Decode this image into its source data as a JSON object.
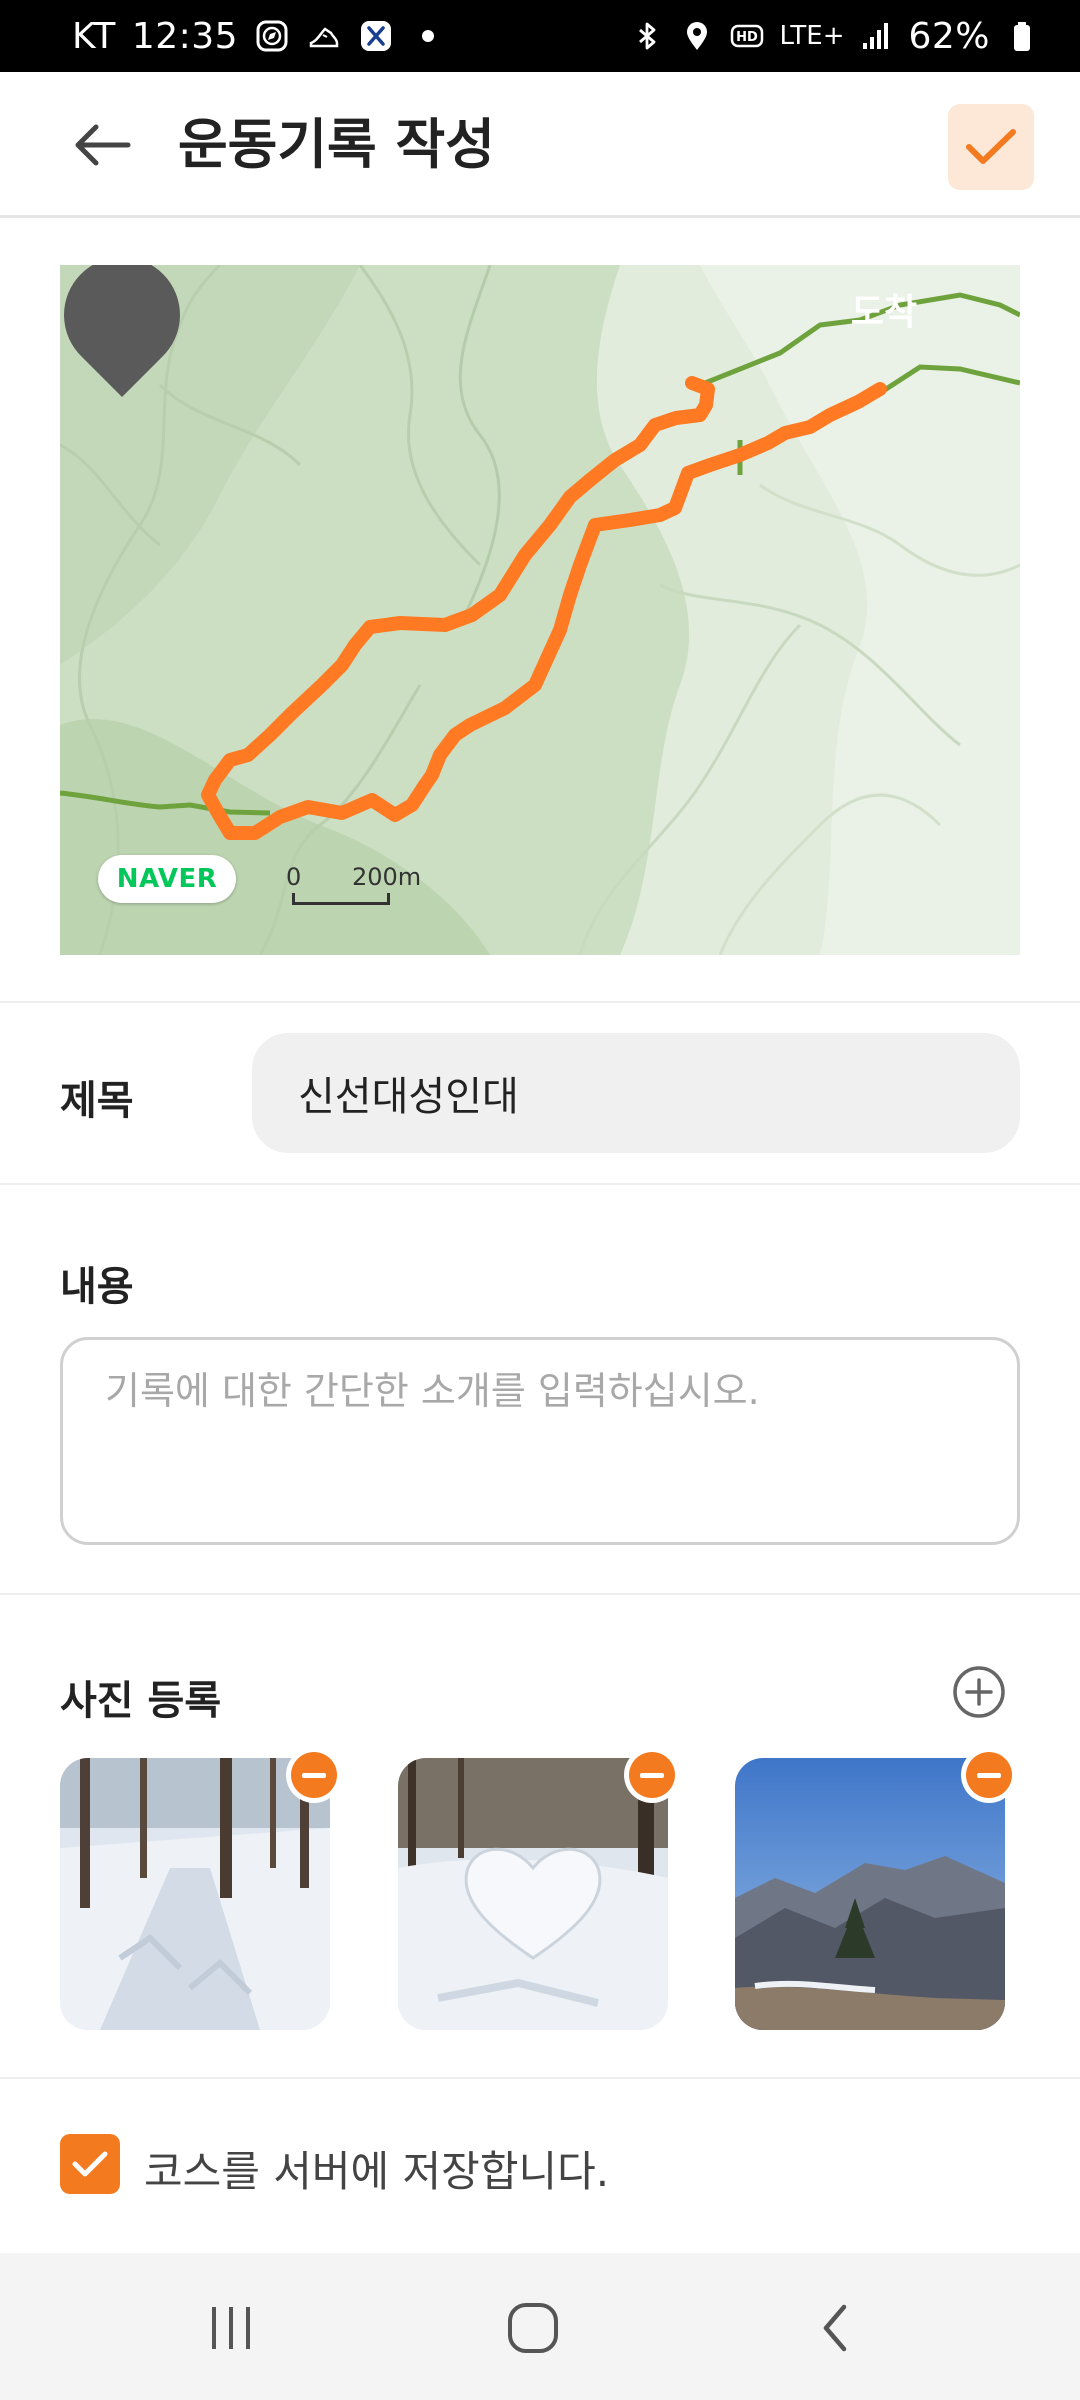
{
  "status_bar": {
    "carrier": "KT",
    "time": "12:35",
    "network": "LTE+",
    "battery": "62%",
    "icons": [
      "compass-icon",
      "running-shoe-icon",
      "x-app-icon",
      "dot-icon",
      "bluetooth-icon",
      "location-icon",
      "hd-icon",
      "signal-icon",
      "battery-icon"
    ]
  },
  "header": {
    "title": "운동기록 작성",
    "back_icon": "arrow-left-icon",
    "confirm_icon": "check-icon"
  },
  "map": {
    "arrival_label": "도착",
    "brand": "NAVER",
    "scale_zero": "0",
    "scale_label": "200m",
    "route_color": "#ff7a22"
  },
  "form": {
    "title_label": "제목",
    "title_value": "신선대성인대",
    "content_label": "내용",
    "content_placeholder": "기록에 대한 간단한 소개를 입력하십시오.",
    "photo_label": "사진 등록",
    "photos": [
      {
        "description": "snowy forest trail",
        "remove_icon": "minus-circle-icon"
      },
      {
        "description": "snow heart sculpture",
        "remove_icon": "minus-circle-icon"
      },
      {
        "description": "mountain range view",
        "remove_icon": "minus-circle-icon"
      }
    ],
    "save_course_label": "코스를 서버에 저장합니다.",
    "save_course_checked": true
  },
  "nav": {
    "recents_icon": "recents-icon",
    "home_icon": "home-icon",
    "back_icon": "nav-back-icon"
  },
  "colors": {
    "accent": "#f47a20",
    "confirm_bg": "#fde8d8"
  }
}
